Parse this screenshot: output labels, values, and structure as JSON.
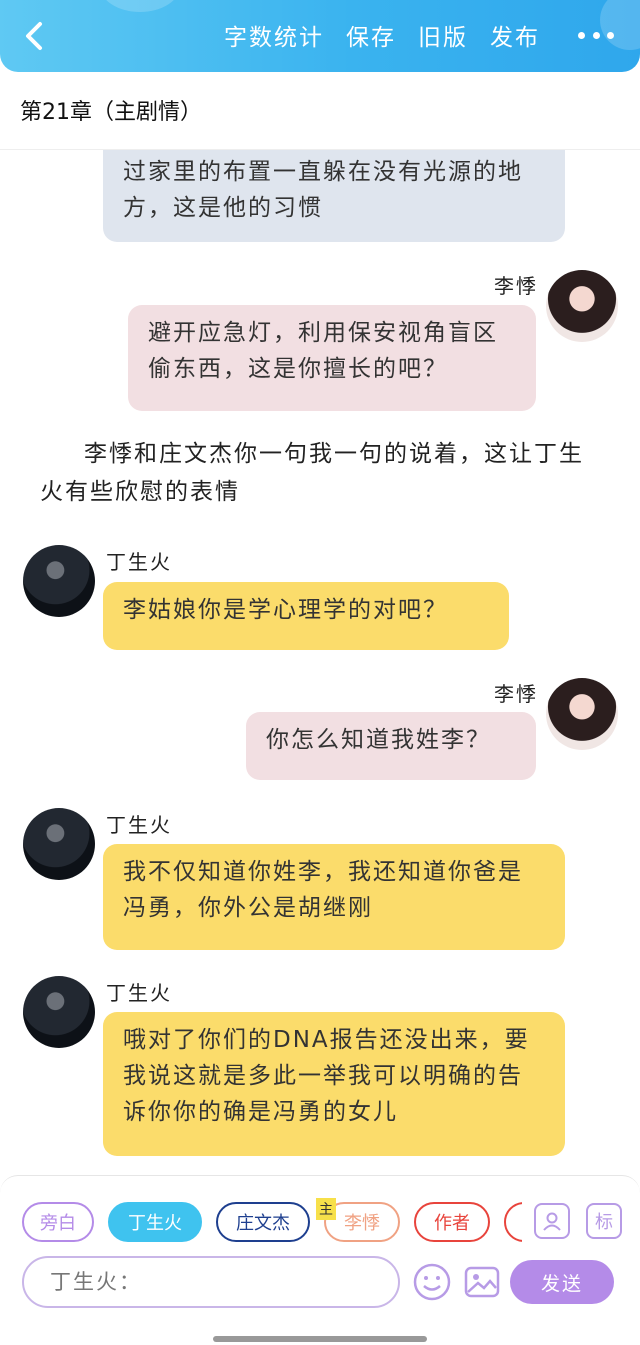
{
  "header": {
    "actions": [
      "字数统计",
      "保存",
      "旧版",
      "发布"
    ],
    "chapter_title": "第21章（主剧情）"
  },
  "messages": [
    {
      "speaker": "",
      "text": "过家里的布置一直躲在没有光源的地方，这是他的习惯"
    },
    {
      "speaker": "李悸",
      "text": "避开应急灯，利用保安视角盲区偷东西，这是你擅长的吧？"
    },
    {
      "speaker": "",
      "text": "李悸和庄文杰你一句我一句的说着，这让丁生火有些欣慰的表情"
    },
    {
      "speaker": "丁生火",
      "text": "李姑娘你是学心理学的对吧？"
    },
    {
      "speaker": "李悸",
      "text": "你怎么知道我姓李？"
    },
    {
      "speaker": "丁生火",
      "text": "我不仅知道你姓李，我还知道你爸是冯勇，你外公是胡继刚"
    },
    {
      "speaker": "丁生火",
      "text": "哦对了你们的DNA报告还没出来，要我说这就是多此一举我可以明确的告诉你你的确是冯勇的女儿"
    }
  ],
  "roles": [
    {
      "label": "旁白",
      "color": "#b48be8"
    },
    {
      "label": "丁生火",
      "color": "#3fc3ef"
    },
    {
      "label": "庄文杰",
      "color": "#1e3f8f"
    },
    {
      "label": "李悸",
      "color": "#f0a283"
    },
    {
      "label": "作者",
      "color": "#e8443c"
    }
  ],
  "main_badge": "主",
  "tools": {
    "role_manage": "",
    "tag": "标"
  },
  "composer": {
    "speaker_prefix": "丁生火：",
    "send_label": "发送"
  }
}
